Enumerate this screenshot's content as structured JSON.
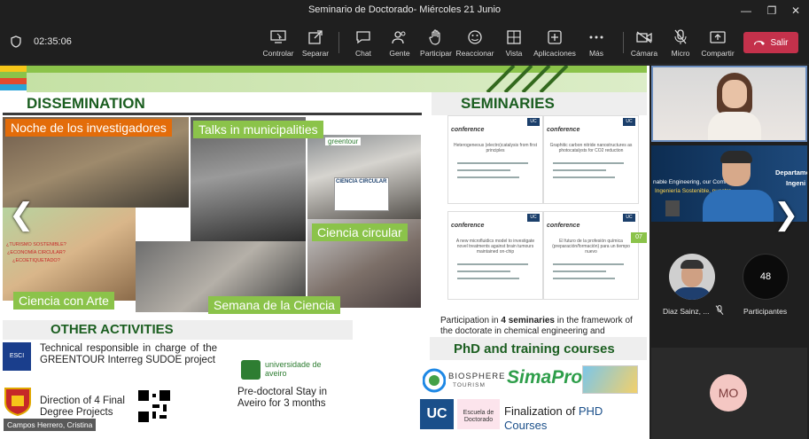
{
  "window": {
    "title": "Seminario de Doctorado- Miércoles 21 Junio"
  },
  "toolbar": {
    "elapsed": "02:35:06",
    "controlar": "Controlar",
    "compartir_contenido": "Separar",
    "chat": "Chat",
    "gente": "Gente",
    "participar": "Participar",
    "reaccionar": "Reaccionar",
    "vista": "Vista",
    "aplicaciones": "Aplicaciones",
    "mas": "Más",
    "camara": "Cámara",
    "micro": "Micro",
    "compartir": "Compartir",
    "salir": "Salir"
  },
  "slide": {
    "dissemination": "DISSEMINATION",
    "seminaries": "SEMINARIES",
    "labels": {
      "noche": "Noche de los investigadores",
      "talks": "Talks in municipalities",
      "circular": "Ciencia circular",
      "arte": "Ciencia con Arte",
      "semana": "Semana de la Ciencia"
    },
    "photo_text": {
      "greentour": "greentour",
      "ciencia_circular_poster": "CIENCIA CIRCULAR",
      "sostenible": "¿TURISMO SOSTENIBLE?",
      "economia": "¿ECONOMÍA CIRCULAR?",
      "ecoetiquetado": "¿ECOETIQUETADO?"
    },
    "other_activities": "OTHER ACTIVITIES",
    "technical": "Technical responsible in charge of the GREENTOUR Interreg SUDOE project",
    "esci": "ESCI",
    "direction": "Direction of 4 Final Degree Projects",
    "aveiro_logo": "universidade de aveiro",
    "predoc": "Pre-doctoral Stay in Aveiro for 3 months",
    "page_no": "07",
    "participation_pre": "Participation in ",
    "participation_bold": "4 seminaries",
    "participation_post": " in the framework of the doctorate in chemical engineering and processes",
    "phd": "PhD and training courses",
    "biosphere": "BIOSPHERE",
    "tourism": "TOURISM",
    "simapro": "SimaPro",
    "uc": "UC",
    "escuela": "Escuela de Doctorado",
    "finalization_pre": "Finalization of ",
    "finalization_post": "PHD Courses",
    "posters": [
      {
        "word": "conference",
        "title": "Heterogeneous (electro)catalysis from first principles"
      },
      {
        "word": "conference",
        "title": "Graphitic carbon nitride nanostructures as photocatalysts for CO2 reduction"
      },
      {
        "word": "conference",
        "title": "A new microfluidics model to investigate novel treatments against brain tumours maintained on-chip"
      },
      {
        "word": "conference",
        "title": "El futuro de la profesión química (preparación/formación) para un tiempo nuevo"
      }
    ],
    "poster_badge": "UC"
  },
  "presenter_name": "Campos Herrero, Cristina",
  "side": {
    "banner_line1": "nable Engineering, our Commo",
    "banner_line2": "Ingeniería Sostenible, nuestro",
    "banner_dept": "Departame",
    "banner_ing": "Ingeni",
    "participant_name": "Diaz Sainz, ...",
    "participants_count": "48",
    "participants_label": "Participantes",
    "mo_initials": "MO"
  },
  "colors": {
    "leave": "#c4314b",
    "slide_green": "#1b5e20",
    "label_orange": "#e36c0a",
    "label_green": "#8bc34a"
  }
}
